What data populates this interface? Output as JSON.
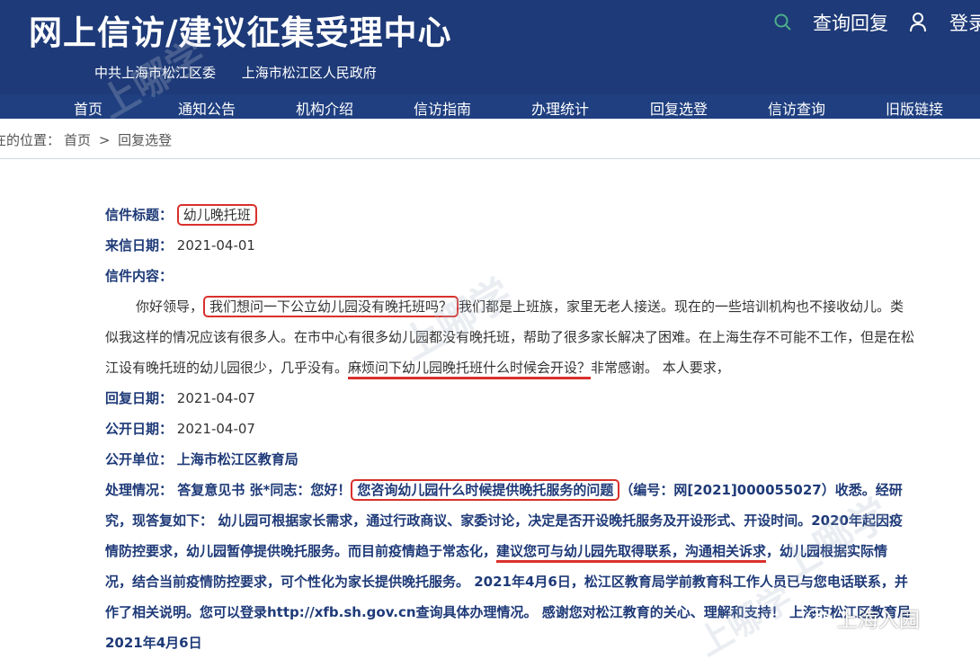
{
  "header": {
    "site_title": "网上信访/建议征集受理中心",
    "sub_links": [
      "中共上海市松江区委",
      "上海市松江区人民政府"
    ],
    "query_reply": "查询回复",
    "login": "登录"
  },
  "nav": {
    "items": [
      "首页",
      "通知公告",
      "机构介绍",
      "信访指南",
      "办理统计",
      "回复选登",
      "信访查询",
      "旧版链接"
    ]
  },
  "breadcrumb": {
    "prefix": "在的位置：",
    "home": "首页",
    "separator": ">",
    "current": "回复选登"
  },
  "letter": {
    "title_label": "信件标题：",
    "title_value": "幼儿晚托班",
    "date_label": "来信日期：",
    "date_value": "2021-04-01",
    "content_label": "信件内容：",
    "content_p1": "你好领导，",
    "content_q1": "我们想问一下公立幼儿园没有晚托班吗？",
    "content_p2": "我们都是上班族，家里无老人接送。现在的一些培训机构也不接收幼儿。类似我这样的情况应该有很多人。在市中心有很多幼儿园都没有晚托班，帮助了很多家长解决了困难。在上海生存不可能不工作，但是在松江设有晚托班的幼儿园很少，几乎没有。",
    "content_q2": "麻烦问下幼儿园晚托班什么时候会开设？",
    "content_p3": "非常感谢。 本人要求，",
    "reply_date_label": "回复日期：",
    "reply_date_value": "2021-04-07",
    "public_date_label": "公开日期：",
    "public_date_value": "2021-04-07",
    "public_unit_label": "公开单位：",
    "public_unit_value": "上海市松江区教育局",
    "handling_label": "处理情况：",
    "handling_p1": "答复意见书 张*同志：您好！",
    "handling_q1": "您咨询幼儿园什么时候提供晚托服务的问题",
    "handling_p2": "（编号：网[2021]000055027）收悉。经研究，现答复如下： 幼儿园可根据家长需求，通过行政商议、家委讨论，决定是否开设晚托服务及开设形式、开设时间。2020年起因疫情防控要求，幼儿园暂停提供晚托服务。而目前疫情趋于常态化，",
    "handling_q2": "建议您可与幼儿园先取得联系，沟通相关诉求",
    "handling_p3": "，幼儿园根据实际情况，结合当前疫情防控要求，可个性化为家长提供晚托服务。 2021年4月6日，松江区教育局学前教育科工作人员已与您电话联系，并作了相关说明。您可以登录http://xfb.sh.gov.cn查询具体办理情况。 感谢您对松江教育的关心、理解和支持！ 上海市松江区教育局 2021年4月6日"
  },
  "watermark": {
    "text": "上哪学",
    "brand": "上海入园"
  },
  "colors": {
    "header_bg": "#1e3a78",
    "label_color": "#1e3a78",
    "highlight_red": "#d9302c",
    "search_icon": "#4caf8a"
  }
}
